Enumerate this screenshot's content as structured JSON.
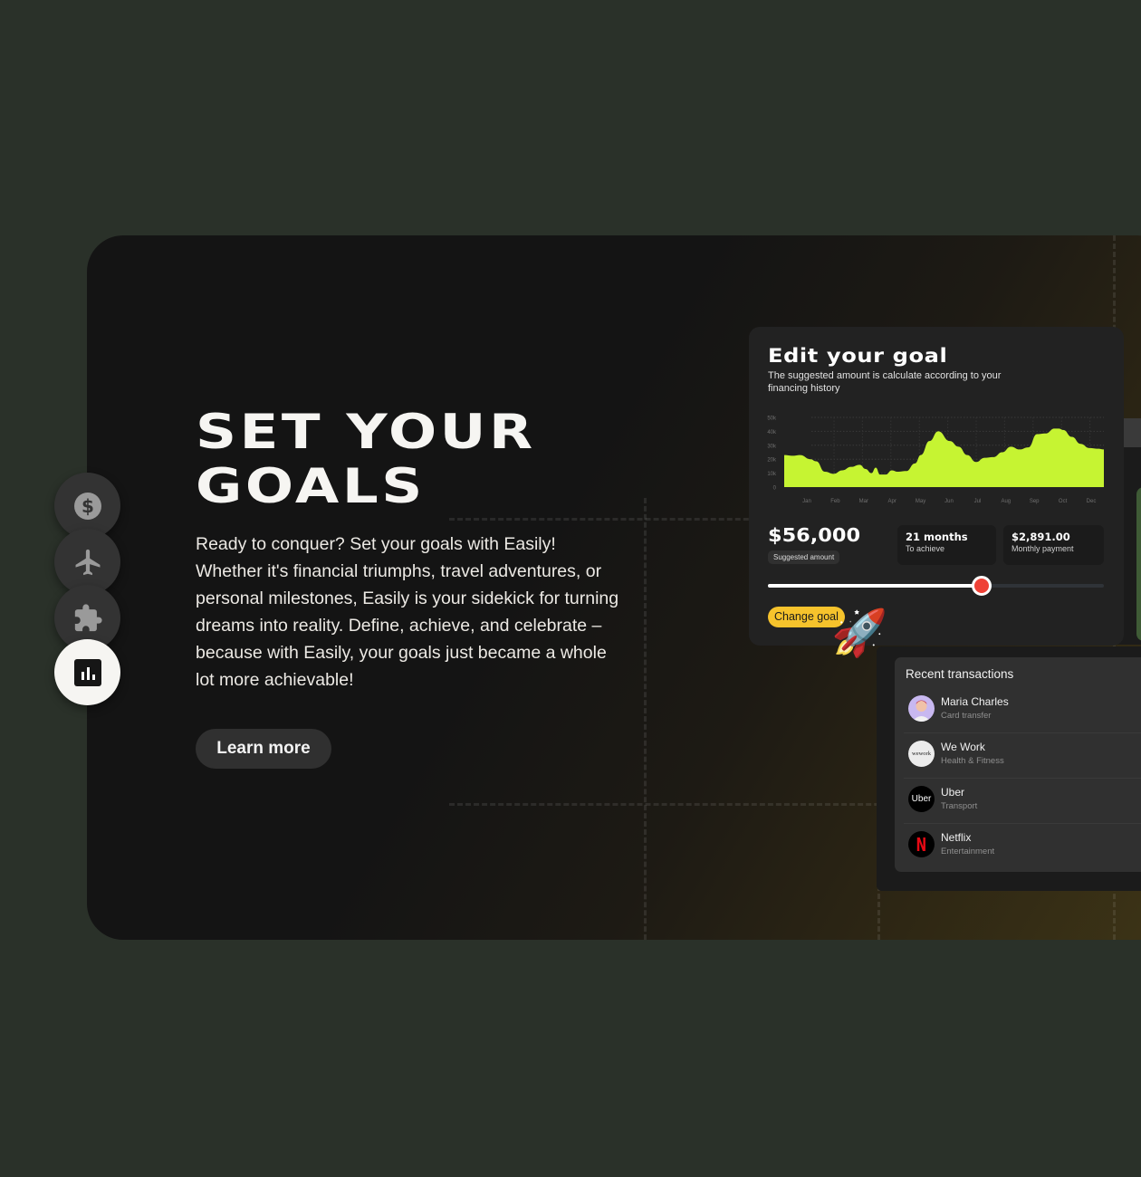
{
  "hero": {
    "title_line1": "SET YOUR",
    "title_line2": "GOALS",
    "body": "Ready to conquer? Set your goals with Easily! Whether it's financial triumphs, travel adventures, or personal milestones, Easily is your sidekick for turning dreams into reality. Define, achieve, and celebrate – because with Easily, your goals just became a whole lot more achievable!",
    "cta_label": "Learn more"
  },
  "side_nav": [
    {
      "icon": "dollar-icon",
      "active": false
    },
    {
      "icon": "airplane-icon",
      "active": false
    },
    {
      "icon": "puzzle-icon",
      "active": false
    },
    {
      "icon": "bar-chart-icon",
      "active": true
    }
  ],
  "goal_panel": {
    "title": "Edit your goal",
    "subtitle": "The suggested amount is calculate according to your financing history",
    "amount": "$56,000",
    "amount_label": "Suggested amount",
    "stats": [
      {
        "value": "21 months",
        "label": "To achieve"
      },
      {
        "value": "$2,891.00",
        "label": "Monthly payment"
      }
    ],
    "slider_progress": 0.635,
    "change_goal_label": "Change goal",
    "accent": "#c6f432",
    "slider_thumb_color": "#ef4136",
    "button_color": "#f6c32c"
  },
  "chart_data": {
    "type": "area",
    "title": "",
    "xlabel": "",
    "ylabel": "",
    "ylim": [
      0,
      50000
    ],
    "yticks": [
      "50k",
      "40k",
      "30k",
      "20k",
      "10k",
      "0"
    ],
    "xticks": [
      "Jan",
      "Feb",
      "Mar",
      "Apr",
      "May",
      "Jun",
      "Jul",
      "Aug",
      "Sep",
      "Oct",
      "Dec"
    ],
    "grid": true,
    "series": [
      {
        "name": "financing",
        "color": "#c6f432",
        "x": [
          0,
          0.3,
          0.55,
          0.9,
          1.1,
          1.4,
          1.7,
          2.0,
          2.3,
          2.6,
          2.8,
          3.0,
          3.15,
          3.3,
          3.5,
          3.7,
          3.9,
          4.2,
          4.5,
          4.7,
          5.0,
          5.3,
          5.7,
          6.0,
          6.3,
          6.6,
          6.9,
          7.2,
          7.5,
          7.8,
          8.1,
          8.4,
          8.7,
          9.0,
          9.3,
          9.45,
          9.6,
          9.9,
          10.2,
          10.5,
          10.8,
          11.0
        ],
        "values": [
          23000,
          22500,
          23000,
          20000,
          18500,
          11000,
          9500,
          12000,
          14500,
          16000,
          13000,
          10000,
          14000,
          9000,
          9000,
          12000,
          11000,
          11500,
          17000,
          23000,
          33000,
          40000,
          33000,
          29000,
          23000,
          18000,
          21000,
          21500,
          25000,
          29000,
          27000,
          28500,
          38000,
          38500,
          42000,
          42000,
          41000,
          36000,
          31000,
          28000,
          27500,
          27000
        ]
      }
    ]
  },
  "transactions": {
    "title": "Recent transactions",
    "items": [
      {
        "name": "Maria Charles",
        "category": "Card transfer",
        "avatar": "person-avatar"
      },
      {
        "name": "We Work",
        "category": "Health & Fitness",
        "avatar": "wework-logo",
        "logo_text": "wework"
      },
      {
        "name": "Uber",
        "category": "Transport",
        "avatar": "uber-logo",
        "logo_text": "Uber"
      },
      {
        "name": "Netflix",
        "category": "Entertainment",
        "avatar": "netflix-logo",
        "logo_text": "N"
      }
    ]
  },
  "decor": {
    "rocket": "🚀"
  }
}
